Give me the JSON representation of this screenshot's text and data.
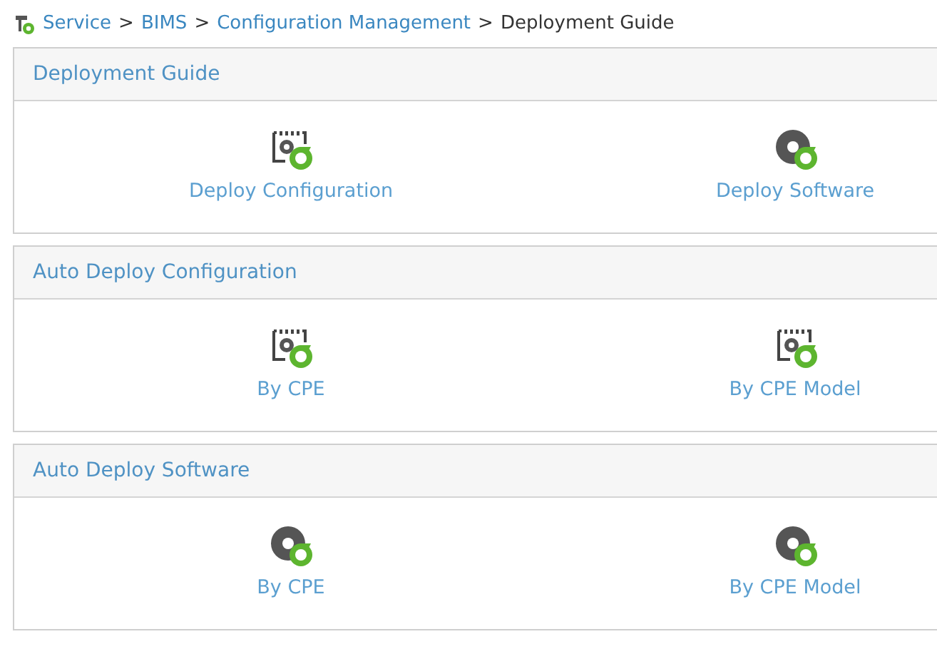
{
  "breadcrumb": [
    {
      "label": "Service",
      "link": true
    },
    {
      "label": "BIMS",
      "link": true
    },
    {
      "label": "Configuration Management",
      "link": true
    },
    {
      "label": "Deployment Guide",
      "link": false
    }
  ],
  "separator": ">",
  "panels": [
    {
      "title": "Deployment Guide",
      "items": [
        {
          "kind": "config",
          "label": "Deploy Configuration"
        },
        {
          "kind": "software",
          "label": "Deploy Software"
        }
      ]
    },
    {
      "title": "Auto Deploy Configuration",
      "items": [
        {
          "kind": "config",
          "label": "By CPE"
        },
        {
          "kind": "config",
          "label": "By CPE Model"
        }
      ]
    },
    {
      "title": "Auto Deploy Software",
      "items": [
        {
          "kind": "software",
          "label": "By CPE"
        },
        {
          "kind": "software",
          "label": "By CPE Model"
        }
      ]
    }
  ]
}
